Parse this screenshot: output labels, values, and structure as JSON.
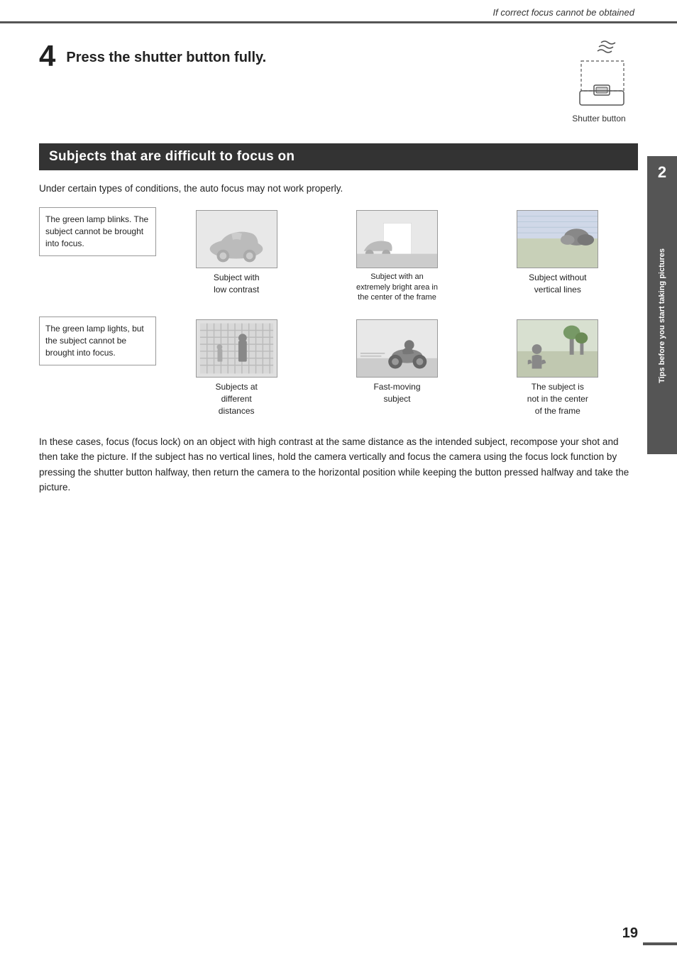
{
  "header": {
    "italic_text": "If correct focus cannot be obtained"
  },
  "side_tab": {
    "number": "2",
    "text": "Tips before you start taking pictures"
  },
  "page_number": "19",
  "step": {
    "number": "4",
    "text": "Press the shutter button fully.",
    "shutter_label": "Shutter button"
  },
  "section": {
    "title": "Subjects that are difficult to focus on",
    "intro": "Under certain types of conditions, the auto focus may not work properly.",
    "green_lamp_blinks": "The green lamp blinks. The subject cannot be brought into focus.",
    "green_lamp_lights": "The green lamp lights, but the subject cannot be brought into focus.",
    "subjects_row1": [
      {
        "label": "Subject with\nlow contrast"
      },
      {
        "label": "Subject with an\nextremely bright area in\nthe center of the frame",
        "small": true
      },
      {
        "label": "Subject without\nvertical lines"
      }
    ],
    "subjects_row2": [
      {
        "label": "Subjects at\ndifferent\ndistances"
      },
      {
        "label": "Fast-moving\nsubject"
      },
      {
        "label": "The subject is\nnot in the center\nof the frame"
      }
    ],
    "bottom_paragraph": "In these cases, focus (focus lock) on an object with high contrast at the same distance as the intended subject, recompose your shot and then take the picture. If the subject has no vertical lines, hold the camera vertically and focus the camera using the focus lock function by pressing the shutter button halfway, then return the camera to the horizontal position while keeping the button pressed halfway and take the picture."
  }
}
